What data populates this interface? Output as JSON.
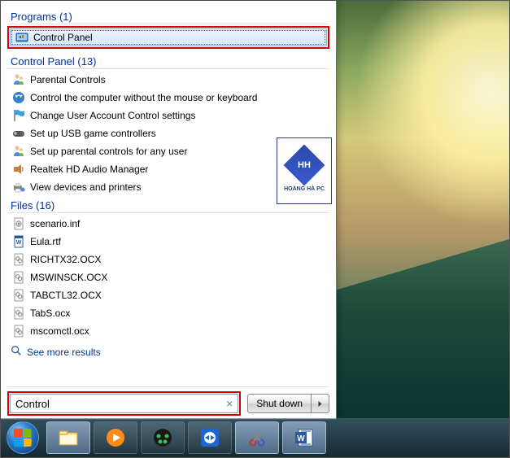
{
  "watermark": {
    "initials": "HH",
    "brand": "HOÀNG HÀ PC"
  },
  "programs": {
    "heading": "Programs (1)",
    "items": [
      {
        "label": "Control Panel",
        "icon": "control-panel-icon",
        "selected": true,
        "highlighted": true
      }
    ]
  },
  "control_panel": {
    "heading": "Control Panel (13)",
    "items": [
      {
        "label": "Parental Controls",
        "icon": "parental-icon"
      },
      {
        "label": "Control the computer without the mouse or keyboard",
        "icon": "ease-icon"
      },
      {
        "label": "Change User Account Control settings",
        "icon": "uac-flag-icon"
      },
      {
        "label": "Set up USB game controllers",
        "icon": "game-controller-icon"
      },
      {
        "label": "Set up parental controls for any user",
        "icon": "parental-icon"
      },
      {
        "label": "Realtek HD Audio Manager",
        "icon": "realtek-icon"
      },
      {
        "label": "View devices and printers",
        "icon": "devices-printers-icon"
      }
    ]
  },
  "files": {
    "heading": "Files (16)",
    "items": [
      {
        "label": "scenario.inf",
        "icon": "inf-icon"
      },
      {
        "label": "Eula.rtf",
        "icon": "word-icon"
      },
      {
        "label": "RICHTX32.OCX",
        "icon": "ocx-icon"
      },
      {
        "label": "MSWINSCK.OCX",
        "icon": "ocx-icon"
      },
      {
        "label": "TABCTL32.OCX",
        "icon": "ocx-icon"
      },
      {
        "label": "TabS.ocx",
        "icon": "ocx-icon"
      },
      {
        "label": "mscomctl.ocx",
        "icon": "ocx-icon"
      }
    ]
  },
  "see_more": "See more results",
  "search": {
    "value": "Control",
    "clear_title": "Clear"
  },
  "shutdown": {
    "label": "Shut down"
  },
  "taskbar_items": [
    {
      "name": "explorer",
      "active": true
    },
    {
      "name": "media-player",
      "active": false
    },
    {
      "name": "coccoc",
      "active": false
    },
    {
      "name": "teamviewer",
      "active": false
    },
    {
      "name": "snipping-tool",
      "active": true
    },
    {
      "name": "word",
      "active": true
    }
  ]
}
